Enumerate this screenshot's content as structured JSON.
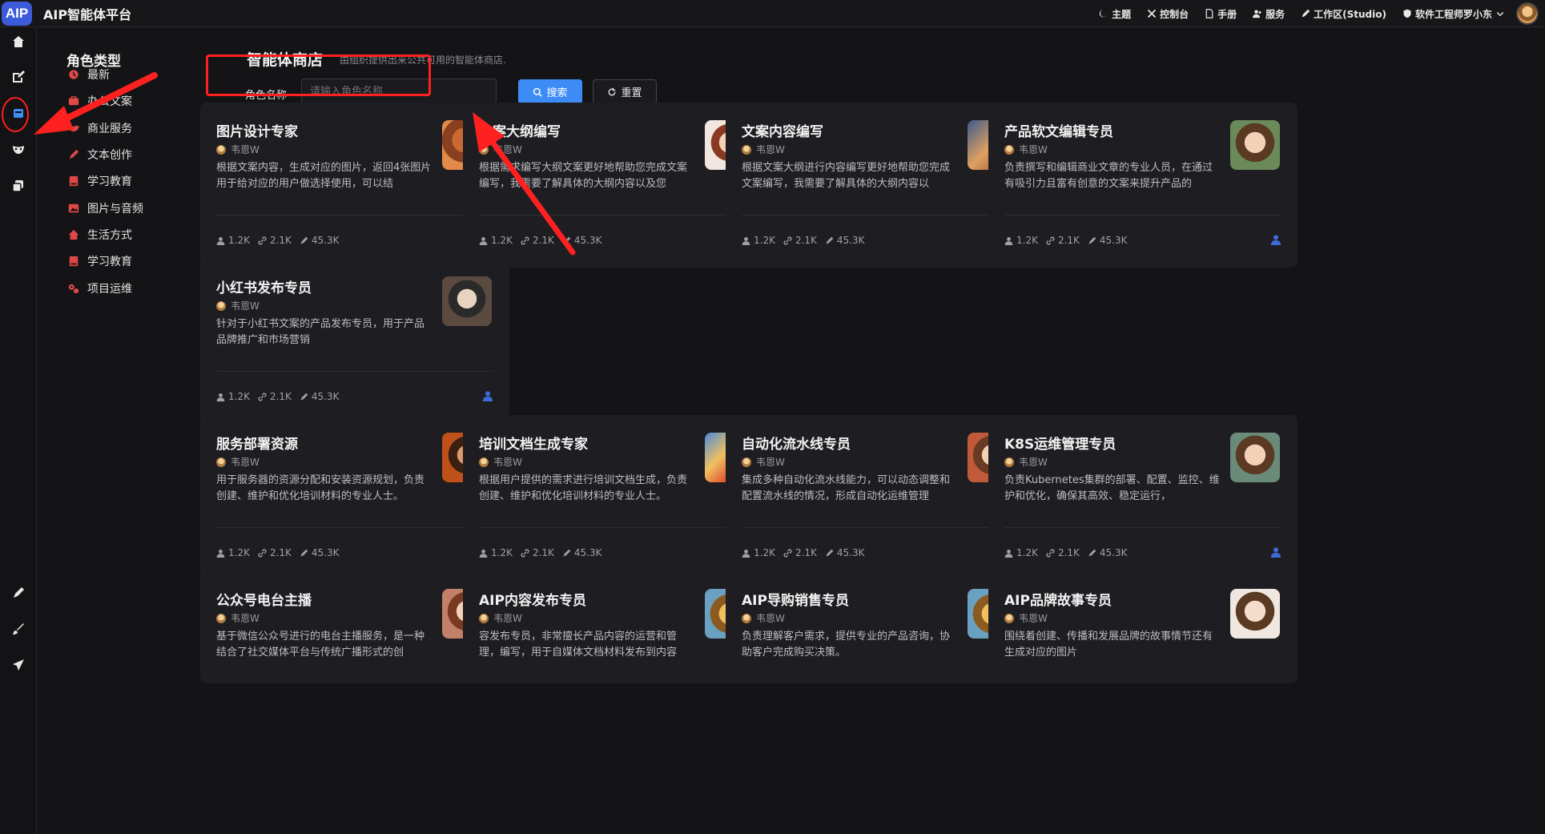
{
  "app": {
    "logo": "AIP",
    "title": "AIP智能体平台"
  },
  "top_menu": [
    {
      "label": "主题",
      "icon": "moon-icon"
    },
    {
      "label": "控制台",
      "icon": "tools-icon"
    },
    {
      "label": "手册",
      "icon": "document-icon"
    },
    {
      "label": "服务",
      "icon": "users-icon"
    },
    {
      "label": "工作区(Studio)",
      "icon": "pen-icon"
    },
    {
      "label": "软件工程师罗小东",
      "icon": "shield-icon"
    }
  ],
  "sidebar_icons": [
    "home-icon",
    "edit-icon",
    "store-icon",
    "mask-icon",
    "copy-icon",
    "pen-icon",
    "brush-icon",
    "send-icon"
  ],
  "categories": {
    "title": "角色类型",
    "items": [
      {
        "label": "最新",
        "icon": "clock-icon",
        "color": "#e04848"
      },
      {
        "label": "办公文案",
        "icon": "briefcase-icon",
        "color": "#e04848"
      },
      {
        "label": "商业服务",
        "icon": "handshake-icon",
        "color": "#e04848"
      },
      {
        "label": "文本创作",
        "icon": "pencil-icon",
        "color": "#e04848"
      },
      {
        "label": "学习教育",
        "icon": "book-icon",
        "color": "#e04848"
      },
      {
        "label": "图片与音频",
        "icon": "image-icon",
        "color": "#e04848"
      },
      {
        "label": "生活方式",
        "icon": "house-icon",
        "color": "#e04848"
      },
      {
        "label": "学习教育",
        "icon": "book-icon",
        "color": "#e04848"
      },
      {
        "label": "项目运维",
        "icon": "gears-icon",
        "color": "#e04848"
      }
    ]
  },
  "store": {
    "title": "智能体商店",
    "subtitle": "由组织提供出来公共可用的智能体商店.",
    "search_label": "角色名称",
    "search_placeholder": "请输入角色名称",
    "search_button": "搜索",
    "reset_button": "重置"
  },
  "agents": [
    {
      "name": "图片设计专家",
      "author": "韦恩W",
      "desc": "根据文案内容，生成对应的图片，返回4张图片用于给对应的用户做选择使用，可以结",
      "users": "1.2K",
      "links": "2.1K",
      "uses": "45.3K"
    },
    {
      "name": "文案大纲编写",
      "author": "韦恩W",
      "desc": "根据需求编写大纲文案更好地帮助您完成文案编写，我需要了解具体的大纲内容以及您",
      "users": "1.2K",
      "links": "2.1K",
      "uses": "45.3K"
    },
    {
      "name": "文案内容编写",
      "author": "韦恩W",
      "desc": "根据文案大纲进行内容编写更好地帮助您完成文案编写，我需要了解具体的大纲内容以",
      "users": "1.2K",
      "links": "2.1K",
      "uses": "45.3K"
    },
    {
      "name": "产品软文编辑专员",
      "author": "韦恩W",
      "desc": "负责撰写和编辑商业文章的专业人员，在通过有吸引力且富有创意的文案来提升产品的",
      "users": "1.2K",
      "links": "2.1K",
      "uses": "45.3K"
    },
    {
      "name": "小红书发布专员",
      "author": "韦恩W",
      "desc": "针对于小红书文案的产品发布专员，用于产品品牌推广和市场营销",
      "users": "1.2K",
      "links": "2.1K",
      "uses": "45.3K"
    },
    {
      "name": "服务部署资源",
      "author": "韦恩W",
      "desc": "用于服务器的资源分配和安装资源规划，负责创建、维护和优化培训材料的专业人士。",
      "users": "1.2K",
      "links": "2.1K",
      "uses": "45.3K"
    },
    {
      "name": "培训文档生成专家",
      "author": "韦恩W",
      "desc": "根据用户提供的需求进行培训文档生成，负责创建、维护和优化培训材料的专业人士。",
      "users": "1.2K",
      "links": "2.1K",
      "uses": "45.3K"
    },
    {
      "name": "自动化流水线专员",
      "author": "韦恩W",
      "desc": "集成多种自动化流水线能力，可以动态调整和配置流水线的情况，形成自动化运维管理",
      "users": "1.2K",
      "links": "2.1K",
      "uses": "45.3K"
    },
    {
      "name": "K8S运维管理专员",
      "author": "韦恩W",
      "desc": "负责Kubernetes集群的部署、配置、监控、维护和优化，确保其高效、稳定运行，",
      "users": "1.2K",
      "links": "2.1K",
      "uses": "45.3K"
    },
    {
      "name": "公众号电台主播",
      "author": "韦恩W",
      "desc": "基于微信公众号进行的电台主播服务，是一种结合了社交媒体平台与传统广播形式的创",
      "users": "",
      "links": "",
      "uses": ""
    },
    {
      "name": "AIP内容发布专员",
      "author": "韦恩W",
      "desc": "容发布专员，非常擅长产品内容的运营和管理，编写，用于自媒体文档材料发布到内容",
      "users": "",
      "links": "",
      "uses": ""
    },
    {
      "name": "AIP导购销售专员",
      "author": "韦恩W",
      "desc": "负责理解客户需求，提供专业的产品咨询，协助客户完成购买决策。",
      "users": "",
      "links": "",
      "uses": ""
    },
    {
      "name": "AIP品牌故事专员",
      "author": "韦恩W",
      "desc": "围绕着创建、传播和发展品牌的故事情节还有生成对应的图片",
      "users": "",
      "links": "",
      "uses": ""
    }
  ],
  "colors": {
    "accent": "#3d8cf5",
    "annotation": "#ff2020",
    "card_bg": "#1e1e22"
  }
}
